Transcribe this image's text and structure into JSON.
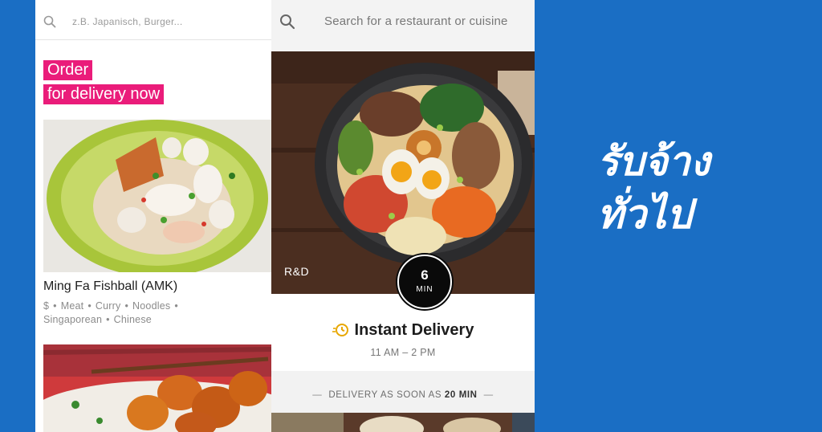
{
  "left_panel": {
    "search_placeholder": "z.B. Japanisch, Burger...",
    "promo": [
      "Order",
      "for delivery now"
    ],
    "restaurant": {
      "name": "Ming Fa Fishball (AMK)",
      "tags": [
        "$",
        "Meat",
        "Curry",
        "Noodles",
        "Singaporean",
        "Chinese"
      ]
    }
  },
  "mid_panel": {
    "search_placeholder": "Search for a restaurant or cuisine",
    "hero_label": "R&D",
    "eta": {
      "value": "6",
      "unit": "MIN"
    },
    "instant": {
      "title": "Instant Delivery",
      "hours": "11 AM – 2 PM"
    },
    "delivery_banner": {
      "prefix": "DELIVERY AS SOON AS",
      "highlight": "20 MIN"
    }
  },
  "headline": [
    "รับจ้าง",
    "ทั่วไป"
  ],
  "colors": {
    "background": "#1a6ec4",
    "promo_pink": "#ea1c7a",
    "accent_clock": "#e8a700"
  },
  "icons": [
    "search-icon",
    "clock-icon"
  ]
}
